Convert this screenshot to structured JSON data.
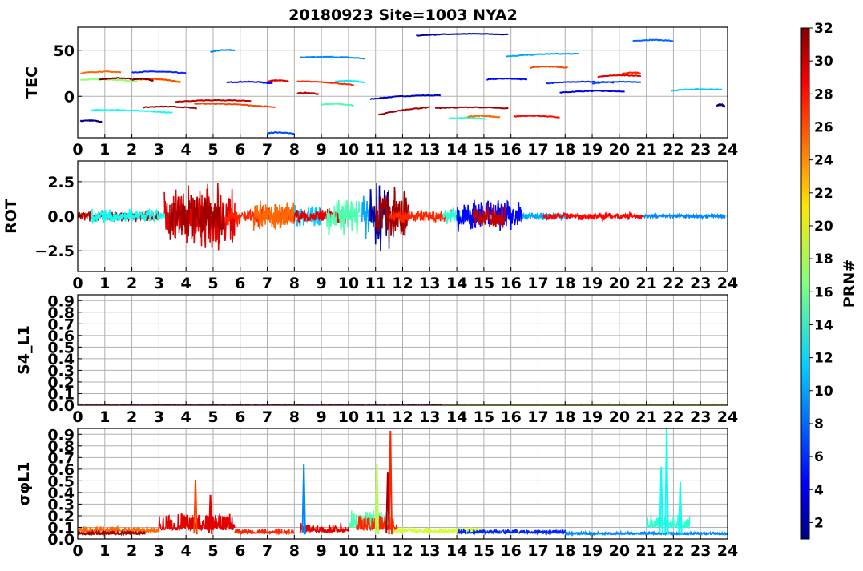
{
  "figure": {
    "title": "20180923 Site=1003 NYA2"
  },
  "chart_data": [
    {
      "type": "line",
      "ylabel": "TEC",
      "xlim": [
        0,
        24
      ],
      "ylim": [
        -45,
        75
      ],
      "yticks": [
        {
          "value": 50,
          "label": "50"
        },
        {
          "value": 0,
          "label": "0"
        }
      ],
      "x_ticks": [
        0,
        1,
        2,
        3,
        4,
        5,
        6,
        7,
        8,
        9,
        10,
        11,
        12,
        13,
        14,
        15,
        16,
        17,
        18,
        19,
        20,
        21,
        22,
        23,
        24
      ],
      "grid": true,
      "series": [
        {
          "prn": 1,
          "x": [
            0.1,
            0.9
          ],
          "y": [
            -27,
            -28
          ]
        },
        {
          "prn": 2,
          "x": [
            12.5,
            15.9
          ],
          "y": [
            66,
            67
          ]
        },
        {
          "prn": 3,
          "x": [
            10.8,
            13.4
          ],
          "y": [
            -3,
            1
          ]
        },
        {
          "prn": 4,
          "x": [
            17.8,
            20.2
          ],
          "y": [
            4,
            5
          ]
        },
        {
          "prn": 5,
          "x": [
            15.1,
            16.6
          ],
          "y": [
            18,
            18
          ]
        },
        {
          "prn": 5,
          "x": [
            5.5,
            7.2
          ],
          "y": [
            15,
            14
          ]
        },
        {
          "prn": 6,
          "x": [
            2.0,
            4.0
          ],
          "y": [
            26,
            25
          ]
        },
        {
          "prn": 6,
          "x": [
            17.3,
            19.8
          ],
          "y": [
            14,
            15
          ]
        },
        {
          "prn": 7,
          "x": [
            19.0,
            20.8
          ],
          "y": [
            14,
            15
          ]
        },
        {
          "prn": 7,
          "x": [
            7.0,
            8.0
          ],
          "y": [
            -40,
            -41
          ]
        },
        {
          "prn": 8,
          "x": [
            20.5,
            22.0
          ],
          "y": [
            60,
            60
          ]
        },
        {
          "prn": 9,
          "x": [
            8.2,
            10.6
          ],
          "y": [
            42,
            41
          ]
        },
        {
          "prn": 9,
          "x": [
            4.9,
            5.8
          ],
          "y": [
            48,
            50
          ]
        },
        {
          "prn": 10,
          "x": [
            15.8,
            18.5
          ],
          "y": [
            43,
            46
          ]
        },
        {
          "prn": 11,
          "x": [
            21.9,
            23.8
          ],
          "y": [
            6,
            7
          ]
        },
        {
          "prn": 12,
          "x": [
            9.5,
            10.6
          ],
          "y": [
            16,
            15
          ]
        },
        {
          "prn": 13,
          "x": [
            0.5,
            3.5
          ],
          "y": [
            -15,
            -18
          ]
        },
        {
          "prn": 14,
          "x": [
            13.7,
            15.1
          ],
          "y": [
            -24,
            -25
          ]
        },
        {
          "prn": 15,
          "x": [
            9.0,
            10.2
          ],
          "y": [
            -9,
            -10
          ]
        },
        {
          "prn": 17,
          "x": [
            0.1,
            2.2
          ],
          "y": [
            18,
            16
          ]
        },
        {
          "prn": 22,
          "x": [
            2.2,
            3.8
          ],
          "y": [
            18,
            16
          ]
        },
        {
          "prn": 25,
          "x": [
            0.1,
            1.6
          ],
          "y": [
            25,
            26
          ]
        },
        {
          "prn": 25,
          "x": [
            14.4,
            15.6
          ],
          "y": [
            -22,
            -23
          ]
        },
        {
          "prn": 26,
          "x": [
            2.5,
            3.8
          ],
          "y": [
            19,
            15
          ]
        },
        {
          "prn": 26,
          "x": [
            16.7,
            18.1
          ],
          "y": [
            31,
            31
          ]
        },
        {
          "prn": 26,
          "x": [
            4.3,
            7.3
          ],
          "y": [
            -8,
            -12
          ]
        },
        {
          "prn": 27,
          "x": [
            8.1,
            10.2
          ],
          "y": [
            16,
            12
          ]
        },
        {
          "prn": 27,
          "x": [
            20.1,
            20.8
          ],
          "y": [
            24,
            25
          ]
        },
        {
          "prn": 28,
          "x": [
            16.1,
            17.8
          ],
          "y": [
            -22,
            -23
          ]
        },
        {
          "prn": 29,
          "x": [
            19.2,
            20.8
          ],
          "y": [
            21,
            22
          ]
        },
        {
          "prn": 29,
          "x": [
            7.0,
            7.8
          ],
          "y": [
            16,
            16
          ]
        },
        {
          "prn": 30,
          "x": [
            8.1,
            8.9
          ],
          "y": [
            3,
            2
          ]
        },
        {
          "prn": 30,
          "x": [
            3.6,
            6.4
          ],
          "y": [
            -6,
            -5
          ]
        },
        {
          "prn": 31,
          "x": [
            2.4,
            4.4
          ],
          "y": [
            -12,
            -13
          ]
        },
        {
          "prn": 31,
          "x": [
            13.2,
            15.9
          ],
          "y": [
            -13,
            -13
          ]
        },
        {
          "prn": 31,
          "x": [
            11.1,
            13.0
          ],
          "y": [
            -20,
            -12
          ]
        },
        {
          "prn": 32,
          "x": [
            0.8,
            2.0
          ],
          "y": [
            18,
            19
          ]
        },
        {
          "prn": 32,
          "x": [
            2.0,
            2.8
          ],
          "y": [
            18,
            17
          ]
        },
        {
          "prn": 1,
          "x": [
            23.6,
            23.9
          ],
          "y": [
            -10,
            -11
          ]
        }
      ]
    },
    {
      "type": "line",
      "ylabel": "ROT",
      "xlim": [
        0,
        24
      ],
      "ylim": [
        -4,
        4
      ],
      "yticks": [
        {
          "value": 2.5,
          "label": "2.5"
        },
        {
          "value": 0,
          "label": "0.0"
        },
        {
          "value": -2.5,
          "label": "−2.5"
        }
      ],
      "x_ticks": [
        0,
        1,
        2,
        3,
        4,
        5,
        6,
        7,
        8,
        9,
        10,
        11,
        12,
        13,
        14,
        15,
        16,
        17,
        18,
        19,
        20,
        21,
        22,
        23,
        24
      ],
      "grid": true,
      "segments": [
        {
          "prn": 30,
          "x0": 0.0,
          "x1": 3.0,
          "amp": 0.45
        },
        {
          "prn": 13,
          "x0": 0.5,
          "x1": 3.4,
          "amp": 0.6
        },
        {
          "prn": 29,
          "x0": 3.2,
          "x1": 5.8,
          "amp": 2.6
        },
        {
          "prn": 31,
          "x0": 3.4,
          "x1": 5.4,
          "amp": 1.8
        },
        {
          "prn": 27,
          "x0": 5.5,
          "x1": 8.0,
          "amp": 0.8
        },
        {
          "prn": 25,
          "x0": 6.5,
          "x1": 8.0,
          "amp": 1.2
        },
        {
          "prn": 11,
          "x0": 8.0,
          "x1": 9.0,
          "amp": 1.0
        },
        {
          "prn": 29,
          "x0": 8.0,
          "x1": 10.0,
          "amp": 0.6
        },
        {
          "prn": 15,
          "x0": 9.2,
          "x1": 10.4,
          "amp": 1.6
        },
        {
          "prn": 10,
          "x0": 10.5,
          "x1": 10.9,
          "amp": 2.0
        },
        {
          "prn": 2,
          "x0": 10.8,
          "x1": 11.5,
          "amp": 3.0
        },
        {
          "prn": 31,
          "x0": 11.0,
          "x1": 12.2,
          "amp": 2.2
        },
        {
          "prn": 27,
          "x0": 11.5,
          "x1": 13.8,
          "amp": 0.55
        },
        {
          "prn": 14,
          "x0": 13.5,
          "x1": 14.8,
          "amp": 0.7
        },
        {
          "prn": 5,
          "x0": 14.0,
          "x1": 16.4,
          "amp": 1.3
        },
        {
          "prn": 30,
          "x0": 14.6,
          "x1": 15.8,
          "amp": 1.0
        },
        {
          "prn": 10,
          "x0": 16.4,
          "x1": 18.2,
          "amp": 0.35
        },
        {
          "prn": 28,
          "x0": 17.2,
          "x1": 20.9,
          "amp": 0.3
        },
        {
          "prn": 9,
          "x0": 20.9,
          "x1": 23.9,
          "amp": 0.18
        }
      ]
    },
    {
      "type": "line",
      "ylabel": "S4_L1",
      "xlim": [
        0,
        24
      ],
      "ylim": [
        0,
        0.95
      ],
      "yticks": [
        {
          "value": 0.0,
          "label": "0.0"
        },
        {
          "value": 0.1,
          "label": "0.1"
        },
        {
          "value": 0.2,
          "label": "0.2"
        },
        {
          "value": 0.3,
          "label": "0.3"
        },
        {
          "value": 0.4,
          "label": "0.4"
        },
        {
          "value": 0.5,
          "label": "0.5"
        },
        {
          "value": 0.6,
          "label": "0.6"
        },
        {
          "value": 0.7,
          "label": "0.7"
        },
        {
          "value": 0.8,
          "label": "0.8"
        },
        {
          "value": 0.9,
          "label": "0.9"
        }
      ],
      "x_ticks": [
        0,
        1,
        2,
        3,
        4,
        5,
        6,
        7,
        8,
        9,
        10,
        11,
        12,
        13,
        14,
        15,
        16,
        17,
        18,
        19,
        20,
        21,
        22,
        23,
        24
      ],
      "grid": true,
      "segments": [
        {
          "prn": 29,
          "x0": 0.0,
          "x1": 13.5,
          "amp": 0.004
        },
        {
          "prn": 20,
          "x0": 13.5,
          "x1": 18.5,
          "amp": 0.006
        },
        {
          "prn": 19,
          "x0": 18.5,
          "x1": 24.0,
          "amp": 0.01
        }
      ]
    },
    {
      "type": "line",
      "ylabel": "σφL1",
      "xlim": [
        0,
        24
      ],
      "ylim": [
        0,
        0.95
      ],
      "yticks": [
        {
          "value": 0.0,
          "label": "0.0"
        },
        {
          "value": 0.1,
          "label": "0.1"
        },
        {
          "value": 0.2,
          "label": "0.2"
        },
        {
          "value": 0.3,
          "label": "0.3"
        },
        {
          "value": 0.4,
          "label": "0.4"
        },
        {
          "value": 0.5,
          "label": "0.5"
        },
        {
          "value": 0.6,
          "label": "0.6"
        },
        {
          "value": 0.7,
          "label": "0.7"
        },
        {
          "value": 0.8,
          "label": "0.8"
        },
        {
          "value": 0.9,
          "label": "0.9"
        }
      ],
      "x_ticks": [
        0,
        1,
        2,
        3,
        4,
        5,
        6,
        7,
        8,
        9,
        10,
        11,
        12,
        13,
        14,
        15,
        16,
        17,
        18,
        19,
        20,
        21,
        22,
        23,
        24
      ],
      "grid": true,
      "segments": [
        {
          "prn": 25,
          "x0": 0.0,
          "x1": 3.0,
          "base": 0.06,
          "amp": 0.05
        },
        {
          "prn": 31,
          "x0": 0.0,
          "x1": 2.5,
          "base": 0.04,
          "amp": 0.03
        },
        {
          "prn": 29,
          "x0": 3.0,
          "x1": 5.8,
          "base": 0.08,
          "amp": 0.14
        },
        {
          "prn": 27,
          "x0": 5.8,
          "x1": 8.0,
          "base": 0.05,
          "amp": 0.04
        },
        {
          "prn": 29,
          "x0": 8.2,
          "x1": 10.0,
          "base": 0.06,
          "amp": 0.08
        },
        {
          "prn": 15,
          "x0": 10.0,
          "x1": 11.6,
          "base": 0.1,
          "amp": 0.15
        },
        {
          "prn": 27,
          "x0": 10.3,
          "x1": 11.8,
          "base": 0.08,
          "amp": 0.12
        },
        {
          "prn": 19,
          "x0": 11.6,
          "x1": 15.0,
          "base": 0.06,
          "amp": 0.04
        },
        {
          "prn": 6,
          "x0": 14.0,
          "x1": 18.0,
          "base": 0.05,
          "amp": 0.03
        },
        {
          "prn": 9,
          "x0": 18.0,
          "x1": 24.0,
          "base": 0.04,
          "amp": 0.02
        },
        {
          "prn": 14,
          "x0": 21.0,
          "x1": 22.6,
          "base": 0.1,
          "amp": 0.12
        }
      ],
      "spikes": [
        {
          "prn": 26,
          "x": 4.35,
          "y": 0.51
        },
        {
          "prn": 29,
          "x": 4.9,
          "y": 0.38
        },
        {
          "prn": 9,
          "x": 8.35,
          "y": 0.64
        },
        {
          "prn": 18,
          "x": 11.05,
          "y": 0.64
        },
        {
          "prn": 31,
          "x": 11.45,
          "y": 0.57
        },
        {
          "prn": 27,
          "x": 11.55,
          "y": 0.93
        },
        {
          "prn": 13,
          "x": 21.75,
          "y": 0.95
        },
        {
          "prn": 13,
          "x": 22.25,
          "y": 0.49
        },
        {
          "prn": 13,
          "x": 21.55,
          "y": 0.62
        }
      ]
    }
  ],
  "colorbar": {
    "label": "PRN#",
    "min": 1,
    "max": 32,
    "ticks": [
      2,
      4,
      6,
      8,
      10,
      12,
      14,
      16,
      18,
      20,
      22,
      24,
      26,
      28,
      30,
      32
    ],
    "colormap": "jet"
  }
}
